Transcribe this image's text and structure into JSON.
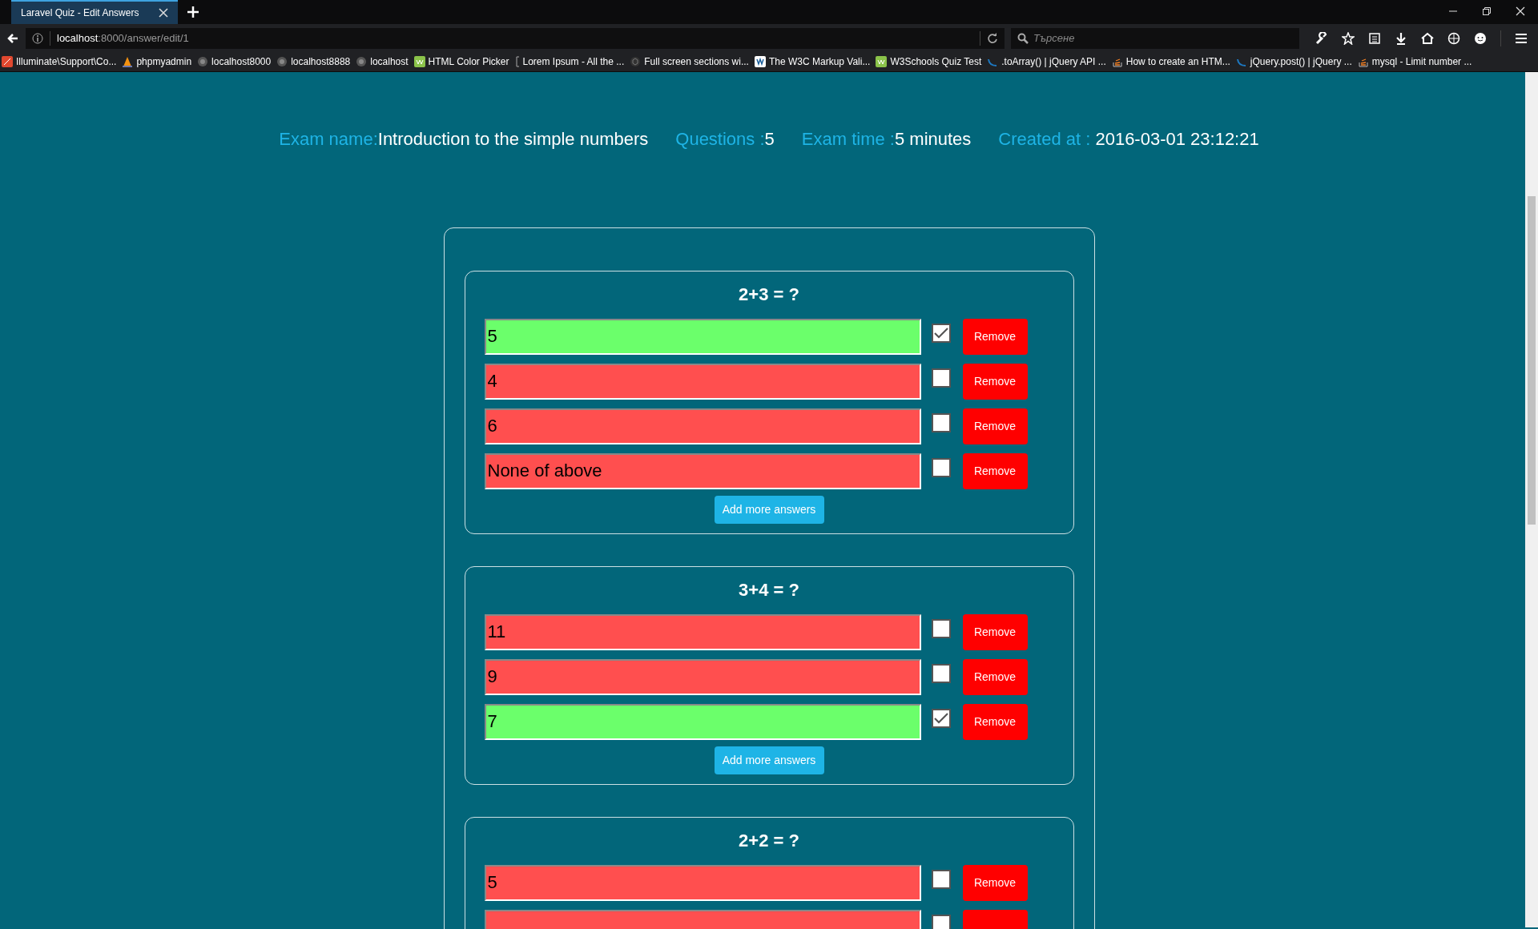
{
  "browser": {
    "tab": {
      "title": "Laravel Quiz - Edit Answers"
    },
    "address": {
      "host": "localhost",
      "rest": ":8000/answer/edit/1"
    },
    "search": {
      "placeholder": "Търсене"
    },
    "bookmarks": [
      {
        "label": "Illuminate\\Support\\Co...",
        "kind": "square"
      },
      {
        "label": "phpmyadmin",
        "kind": "sail"
      },
      {
        "label": "localhost8000",
        "kind": "globe"
      },
      {
        "label": "localhost8888",
        "kind": "globe"
      },
      {
        "label": "localhost",
        "kind": "globe"
      },
      {
        "label": "HTML Color Picker",
        "kind": "w3"
      },
      {
        "label": "Lorem Ipsum - All the ...",
        "kind": "bracket"
      },
      {
        "label": "Full screen sections wi...",
        "kind": "cube"
      },
      {
        "label": "The W3C Markup Vali...",
        "kind": "w3c"
      },
      {
        "label": "W3Schools Quiz Test",
        "kind": "w3"
      },
      {
        "label": ".toArray() | jQuery API ...",
        "kind": "swirl"
      },
      {
        "label": "How to create an HTM...",
        "kind": "stack"
      },
      {
        "label": "jQuery.post() | jQuery ...",
        "kind": "swirl"
      },
      {
        "label": "mysql - Limit number ...",
        "kind": "stack"
      }
    ]
  },
  "exam": [
    {
      "label": "Exam name:",
      "value": "Introduction to the simple numbers"
    },
    {
      "label": "Questions :",
      "value": "5"
    },
    {
      "label": "Exam time :",
      "value": "5 minutes"
    },
    {
      "label": "Created at : ",
      "value": "2016-03-01 23:12:21"
    }
  ],
  "questions": [
    {
      "title": "2+3 = ?",
      "answers": [
        {
          "text": "5",
          "correct": true,
          "remove": "Remove"
        },
        {
          "text": "4",
          "correct": false,
          "remove": "Remove"
        },
        {
          "text": "6",
          "correct": false,
          "remove": "Remove"
        },
        {
          "text": "None of above",
          "correct": false,
          "remove": "Remove"
        }
      ],
      "add_button": "Add more answers"
    },
    {
      "title": "3+4 = ?",
      "answers": [
        {
          "text": "11",
          "correct": false,
          "remove": "Remove"
        },
        {
          "text": "9",
          "correct": false,
          "remove": "Remove"
        },
        {
          "text": "7",
          "correct": true,
          "remove": "Remove"
        }
      ],
      "add_button": "Add more answers"
    },
    {
      "title": "2+2 = ?",
      "answers": [
        {
          "text": "5",
          "correct": false,
          "remove": "Remove"
        },
        {
          "correct": false
        }
      ]
    }
  ]
}
